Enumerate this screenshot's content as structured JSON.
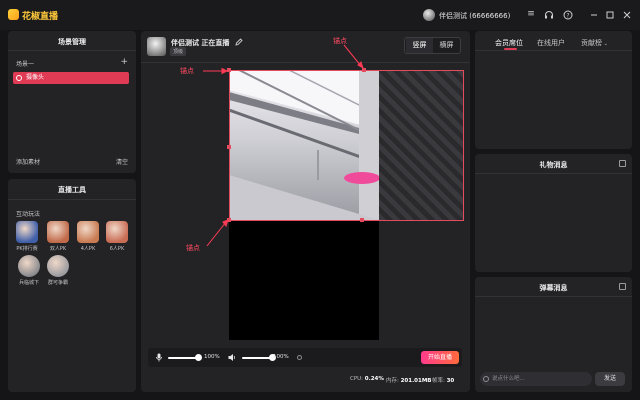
{
  "app": {
    "title": "花椒直播"
  },
  "user": {
    "name": "伴侣测试 (66666666)"
  },
  "titlebar_icons": [
    "menu-icon",
    "headset-icon",
    "help-icon",
    "minimize-icon",
    "maximize-icon",
    "close-icon"
  ],
  "scene_panel": {
    "title": "场景管理",
    "scene_group": "场景一",
    "add_label": "+",
    "scene_item": "摄像头",
    "add_material": "添加素材",
    "clear": "清空"
  },
  "tools_panel": {
    "title": "直播工具",
    "section": "互动玩法",
    "tools": [
      {
        "label": "PK排行赛",
        "color": "#3f5fa8"
      },
      {
        "label": "双人PK",
        "color": "#c06a4a"
      },
      {
        "label": "4人PK",
        "color": "#c97b52"
      },
      {
        "label": "6人PK",
        "color": "#c96d55"
      },
      {
        "label": "兵临城下",
        "color": "#8a8a8e"
      },
      {
        "label": "群可争霸",
        "color": "#9b9ba0"
      }
    ]
  },
  "stream": {
    "title": "伴侣测试 正在直播",
    "badge": "顶级",
    "layout_options": [
      "竖屏",
      "横屏"
    ],
    "active_layout": "竖屏",
    "anchor_label": "锚点"
  },
  "audio": {
    "mic_level_label": "100%",
    "speaker_level_label": "100%",
    "mic_level": 1.0,
    "speaker_level": 1.0
  },
  "start_button": "开始直播",
  "stats": {
    "cpu_label": "CPU:",
    "cpu_value": "0.24%",
    "mem_label": "内存:",
    "mem_value": "201.01MB",
    "fps_label": "帧率:",
    "fps_value": "30"
  },
  "right_panel": {
    "tabs": [
      "会员席位",
      "在线用户",
      "贡献榜"
    ],
    "active_tab": "会员席位",
    "gift_title": "礼物消息",
    "danmaku_title": "弹幕消息",
    "chat_placeholder": "说点什么吧...",
    "send_label": "发送"
  },
  "colors": {
    "accent": "#e03b55",
    "brand": "#ffc93a",
    "background": "#151517",
    "panel": "#232326"
  }
}
